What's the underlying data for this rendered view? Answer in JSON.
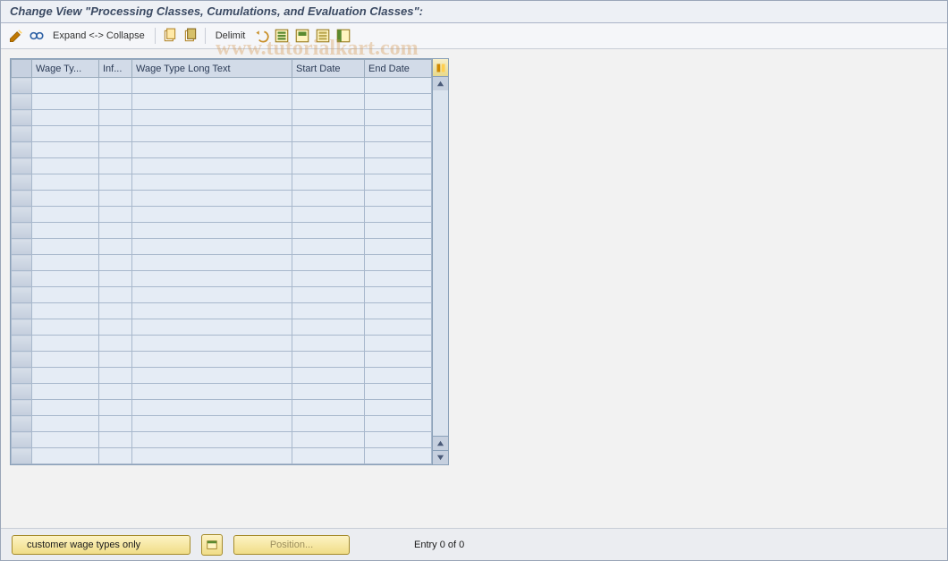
{
  "title": "Change View \"Processing Classes, Cumulations, and Evaluation Classes\":",
  "toolbar": {
    "expand_label": "Expand <-> Collapse",
    "delimit_label": "Delimit"
  },
  "icons": {
    "pencil_glasses": "edit-toggle-icon",
    "glasses": "display-icon",
    "copy": "copy-icon",
    "copy2": "copy-variant-icon",
    "undo": "undo-icon",
    "select_all": "select-all-icon",
    "select_block": "select-block-icon",
    "deselect_all": "deselect-all-icon",
    "column_config": "column-config-icon"
  },
  "table": {
    "columns": [
      "Wage Ty...",
      "Inf...",
      "Wage Type Long Text",
      "Start Date",
      "End Date"
    ],
    "empty_row_count": 24,
    "col_count": 5
  },
  "footer": {
    "customer_btn": "customer wage types only",
    "position_btn": "Position...",
    "entry_text": "Entry 0 of 0"
  },
  "watermark": "www.tutorialkart.com"
}
